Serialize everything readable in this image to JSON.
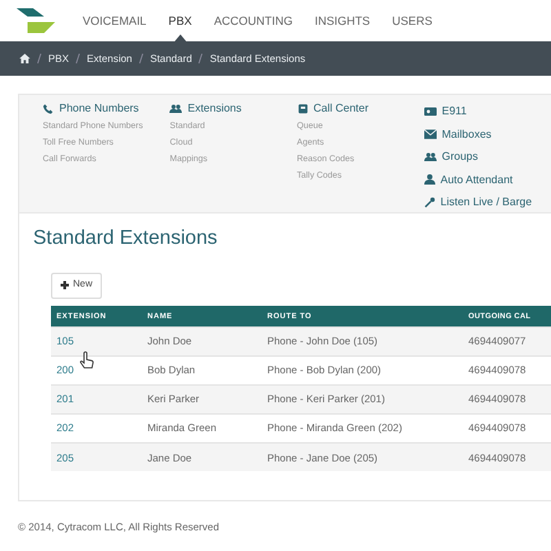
{
  "nav": {
    "items": [
      {
        "label": "VOICEMAIL",
        "selected": false
      },
      {
        "label": "PBX",
        "selected": true
      },
      {
        "label": "ACCOUNTING",
        "selected": false
      },
      {
        "label": "INSIGHTS",
        "selected": false
      },
      {
        "label": "USERS",
        "selected": false
      }
    ]
  },
  "breadcrumb": [
    "PBX",
    "Extension",
    "Standard",
    "Standard Extensions"
  ],
  "menu": {
    "columns": [
      {
        "heading": "Phone Numbers",
        "links": [
          "Standard Phone Numbers",
          "Toll Free Numbers",
          "Call Forwards"
        ]
      },
      {
        "heading": "Extensions",
        "links": [
          "Standard",
          "Cloud",
          "Mappings"
        ]
      },
      {
        "heading": "Call Center",
        "links": [
          "Queue",
          "Agents",
          "Reason Codes",
          "Tally Codes"
        ]
      }
    ],
    "headings": [
      "E911",
      "Mailboxes",
      "Groups",
      "Auto Attendant",
      "Listen Live / Barge"
    ]
  },
  "page_title": "Standard Extensions",
  "new_button": "New",
  "table": {
    "columns": [
      "EXTENSION",
      "NAME",
      "ROUTE TO",
      "OUTGOING CAL"
    ],
    "rows": [
      [
        "105",
        "John Doe",
        "Phone - John Doe (105)",
        "4694409077"
      ],
      [
        "200",
        "Bob Dylan",
        "Phone - Bob Dylan (200)",
        "4694409078"
      ],
      [
        "201",
        "Keri Parker",
        "Phone - Keri Parker (201)",
        "4694409078"
      ],
      [
        "202",
        "Miranda Green",
        "Phone - Miranda Green (202)",
        "4694409078"
      ],
      [
        "205",
        "Jane Doe",
        "Phone - Jane Doe (205)",
        "4694409078"
      ]
    ]
  },
  "footer": "© 2014, Cytracom LLC, All Rights Reserved"
}
